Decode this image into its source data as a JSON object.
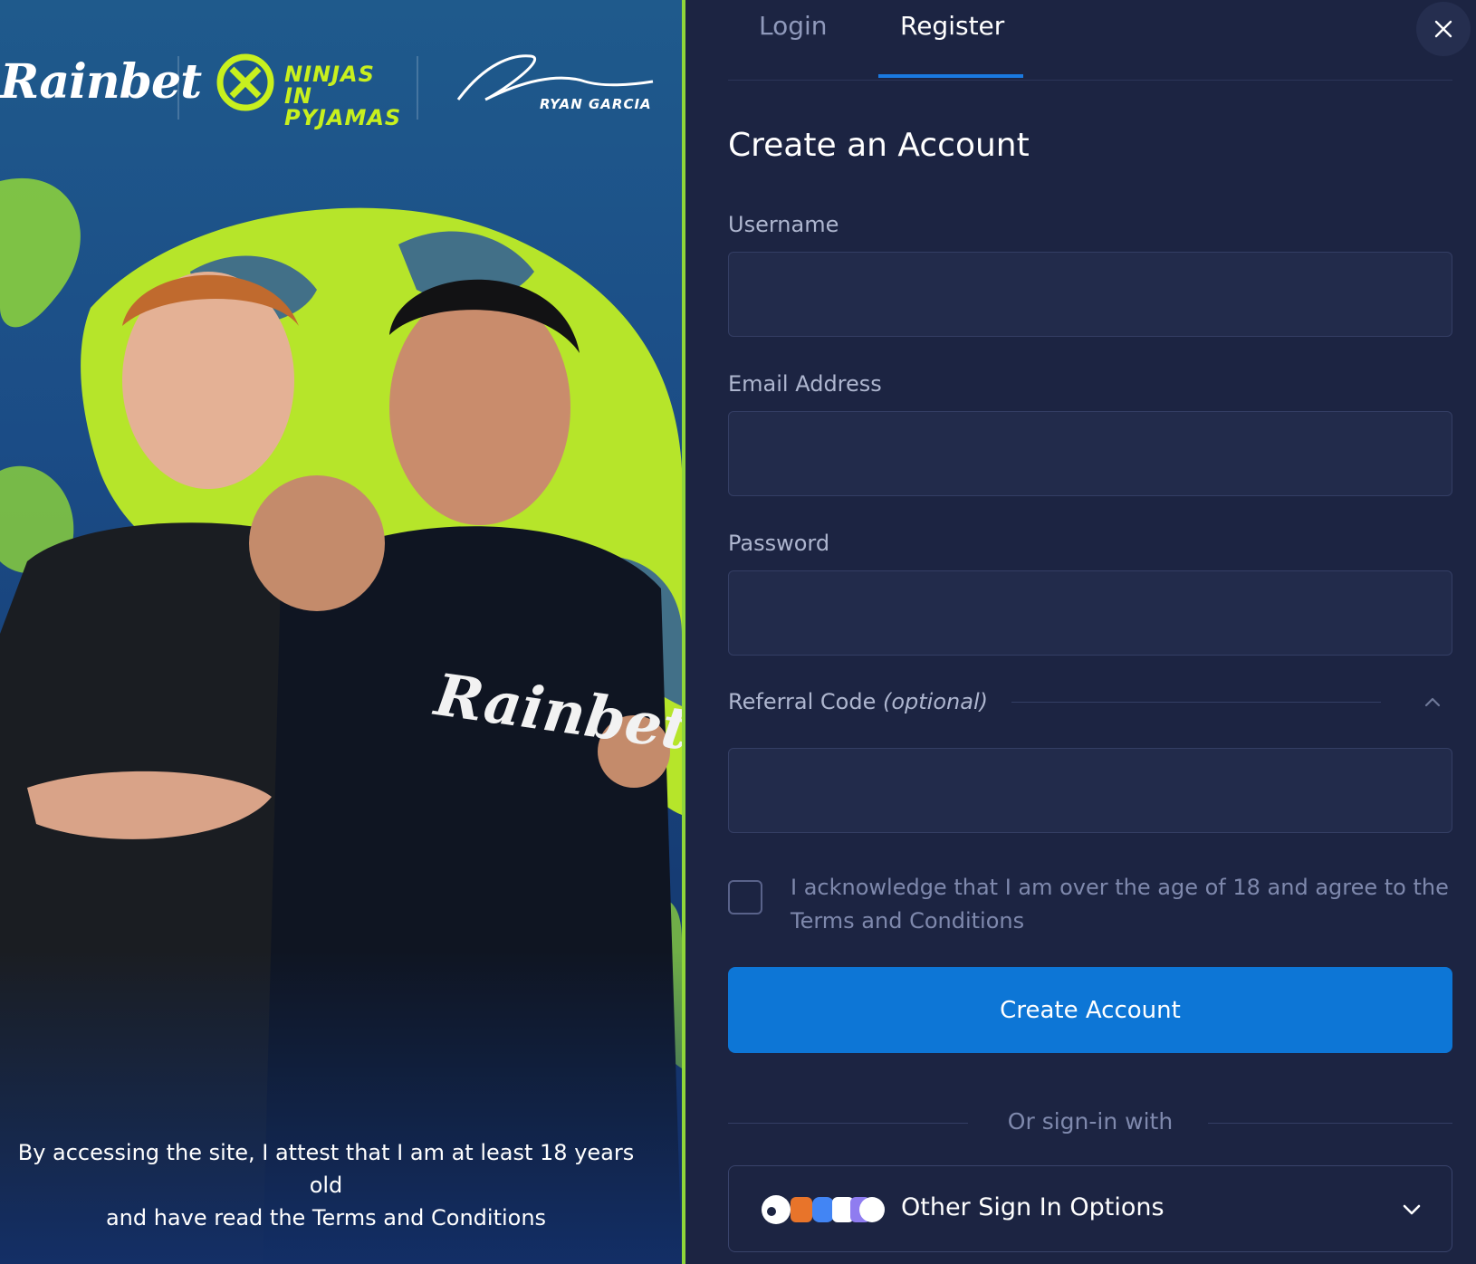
{
  "promo": {
    "brand_logo": "Rainbet",
    "partner_logo_1": "NINJAS IN PYJAMAS",
    "partner_logo_2": "RYAN GARCIA",
    "disclaimer_line1": "By accessing the site, I attest that I am at least 18 years old",
    "disclaimer_line2": "and have read the Terms and Conditions",
    "accent_color": "#c8f01e"
  },
  "tabs": [
    {
      "label": "Login",
      "active": false
    },
    {
      "label": "Register",
      "active": true
    }
  ],
  "close_icon": "close-icon",
  "form": {
    "title": "Create an Account",
    "username": {
      "label": "Username",
      "value": "",
      "placeholder": ""
    },
    "email": {
      "label": "Email Address",
      "value": "",
      "placeholder": ""
    },
    "password": {
      "label": "Password",
      "value": "",
      "placeholder": ""
    },
    "referral": {
      "label": "Referral Code",
      "label_suffix": "(optional)",
      "value": "",
      "placeholder": "",
      "expanded": true
    },
    "acknowledge": {
      "text": "I acknowledge that I am over the age of 18 and agree to the Terms and Conditions",
      "checked": false
    },
    "submit_label": "Create Account",
    "divider_text": "Or sign-in with",
    "other_options_label": "Other Sign In Options"
  },
  "colors": {
    "background": "#1c2442",
    "primary_button": "#0d76d6",
    "tab_active_underline": "#1a79e0",
    "promo_divider": "#8fd63a"
  }
}
